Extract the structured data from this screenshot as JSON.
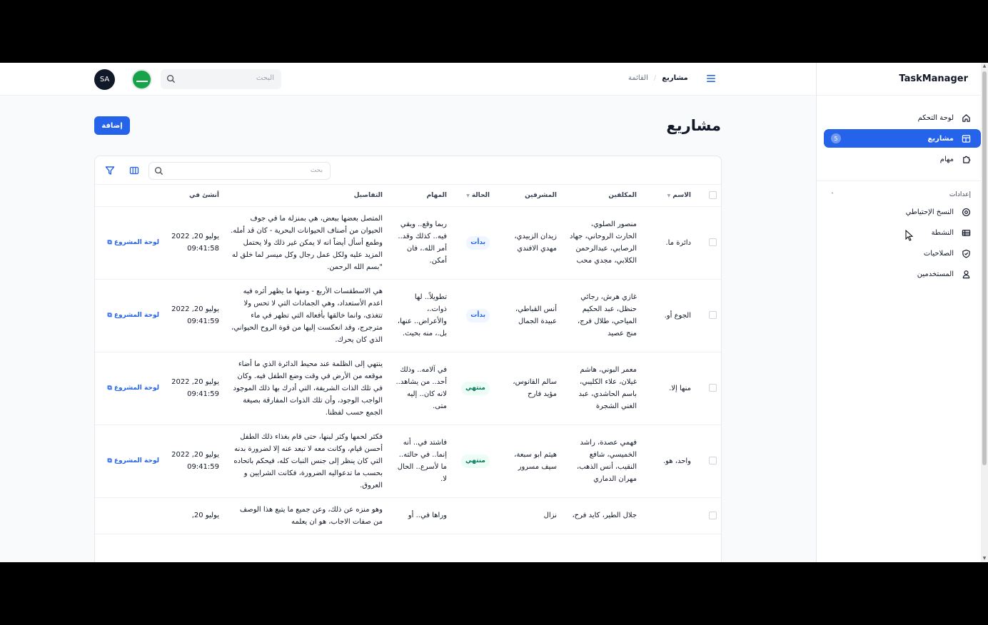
{
  "app": {
    "brand": "TaskManager"
  },
  "sidebar": {
    "items": [
      {
        "label": "لوحة التحكم",
        "icon": "home-icon"
      },
      {
        "label": "مشاريع",
        "icon": "projects-icon",
        "count": "5",
        "active": true
      },
      {
        "label": "مهام",
        "icon": "puzzle-icon"
      }
    ],
    "settings_label": "إعدادات",
    "settings_items": [
      {
        "label": "النسخ الإحتياطي",
        "icon": "backup-icon"
      },
      {
        "label": "النشطة",
        "icon": "table-icon"
      },
      {
        "label": "الصلاحيات",
        "icon": "shield-icon"
      },
      {
        "label": "المستخدمين",
        "icon": "user-icon"
      }
    ]
  },
  "header": {
    "breadcrumb_current": "مشاريع",
    "breadcrumb_parent": "القائمة",
    "search_placeholder": "البحث",
    "avatar_initials": "SA"
  },
  "page": {
    "title": "مشاريع",
    "add_label": "إضافة"
  },
  "table": {
    "search_placeholder": "بحث",
    "columns": {
      "name": "الاسم",
      "assignees": "المكلفين",
      "supervisors": "المشرفين",
      "status": "الحالة",
      "tasks": "المهام",
      "details": "التفاصيل",
      "created": "أنشئ في"
    },
    "link_label": "لوحة المشروع",
    "rows": [
      {
        "name": "دائرة ما.",
        "assignees": "منصور الصلوي، الحارث الروحاني، جهاد الرصابي، عبدالرحمن الكلابي، مجدي محب",
        "supervisors": "زيدان الزبيدي، مهدي الافندي",
        "status": "بدأت",
        "status_type": "started",
        "tasks": "ربما وقع.. ويقي فيه.. كذلك وقد.. أمر الله.، فان أمكن.",
        "details": "المتصل بعضها ببعض، هي بمنزلة ما في جوف الحيوان من أصناف الحيوانات البحرية - كان قد أمله. وطمع أسأل أيضاً انه لا يمكن غير ذلك ولا يحتمل المزيد عليه ولكل عمل رجال وكل ميسر لما خلق له \"بسم الله الرحمن.",
        "created_date": "يوليو 20, 2022",
        "created_time": "09:41:58"
      },
      {
        "name": "الجوع أو.",
        "assignees": "غازي هرش، رجائي حنظل، عبد الحكيم المياحي، طلال فرج، منج عصيد",
        "supervisors": "أنس القباطي، عبيدة الجمال",
        "status": "بدأت",
        "status_type": "started",
        "tasks": "تطويلاً.. لها ذوات.، والأعراض.. عنها، بل.، منه بحيث.",
        "details": "هي الاسطقسات الأربع - ومنها ما يظهر أثره فيه اعدم الأستعداد، وهي الجمادات التي لا تحس ولا تتغذى، وانما خالقها بأفعاله التي تظهر في ماء مترجرج، وقد انعكست إليها من قوة الروح الحيواني، الذي كان يحرك.",
        "created_date": "يوليو 20, 2022",
        "created_time": "09:41:59"
      },
      {
        "name": "منها إلا.",
        "assignees": "معمر البوني، هاشم غيلان، علاء الكليبي، باسم الحاشدي، عبد الغني الشجرة",
        "supervisors": "سالم القانوس، مؤيد فارح",
        "status": "منتهي",
        "status_type": "done",
        "tasks": "في آلامه.. وذلك أحد.. من يشاهد.. لانه كان.. إليه متى.",
        "details": "ينتهي إلى الظلمة عند محيط الدائرة الذي ما أضاء موقعه من الأرض في وقت وضع الطفل فيه. وكان في تلك الذات الشريفة، التي أدرك بها ذلك الموجود الواجب الوجود، وأن تلك الذوات المفارقة بصيغة الجمع حسب لفظنا.",
        "created_date": "يوليو 20, 2022",
        "created_time": "09:41:59"
      },
      {
        "name": "واحد، هو.",
        "assignees": "فهمي عصدة، راشد الخميسي، شافع النقيب، أنس الذهب، مهران الدماري",
        "supervisors": "هيثم ابو سبعة، سيف مسرور",
        "status": "منتهي",
        "status_type": "done",
        "tasks": "فاشتد في.. أنه إنما.. في حالته.. ما لأسرع.. الحال لا.",
        "details": "فكثر لحمها وكثر لبنها، حتى قام بغذاء ذلك الطفل أحسن قيام، وكانت معه لا تبعد عنه إلا لضرورة بدنه التي كان ينظر إلى جنس النبات كله، فيحكم باتحاده بحسب ما تدعواليه الضرورة، فكانت الشرايين و العروق.",
        "created_date": "يوليو 20, 2022",
        "created_time": "09:41:59"
      },
      {
        "name": "",
        "assignees": "جلال الطير، كايد فرح،",
        "supervisors": "نزال",
        "status": "",
        "status_type": "",
        "tasks": "وراها في.. أو",
        "details": "وهو منزه عن ذلك، وعن جميع ما يتبع هذا الوصف من صفات الاجاب، هو ان يعلمه",
        "created_date": "يوليو 20,",
        "created_time": ""
      }
    ]
  }
}
